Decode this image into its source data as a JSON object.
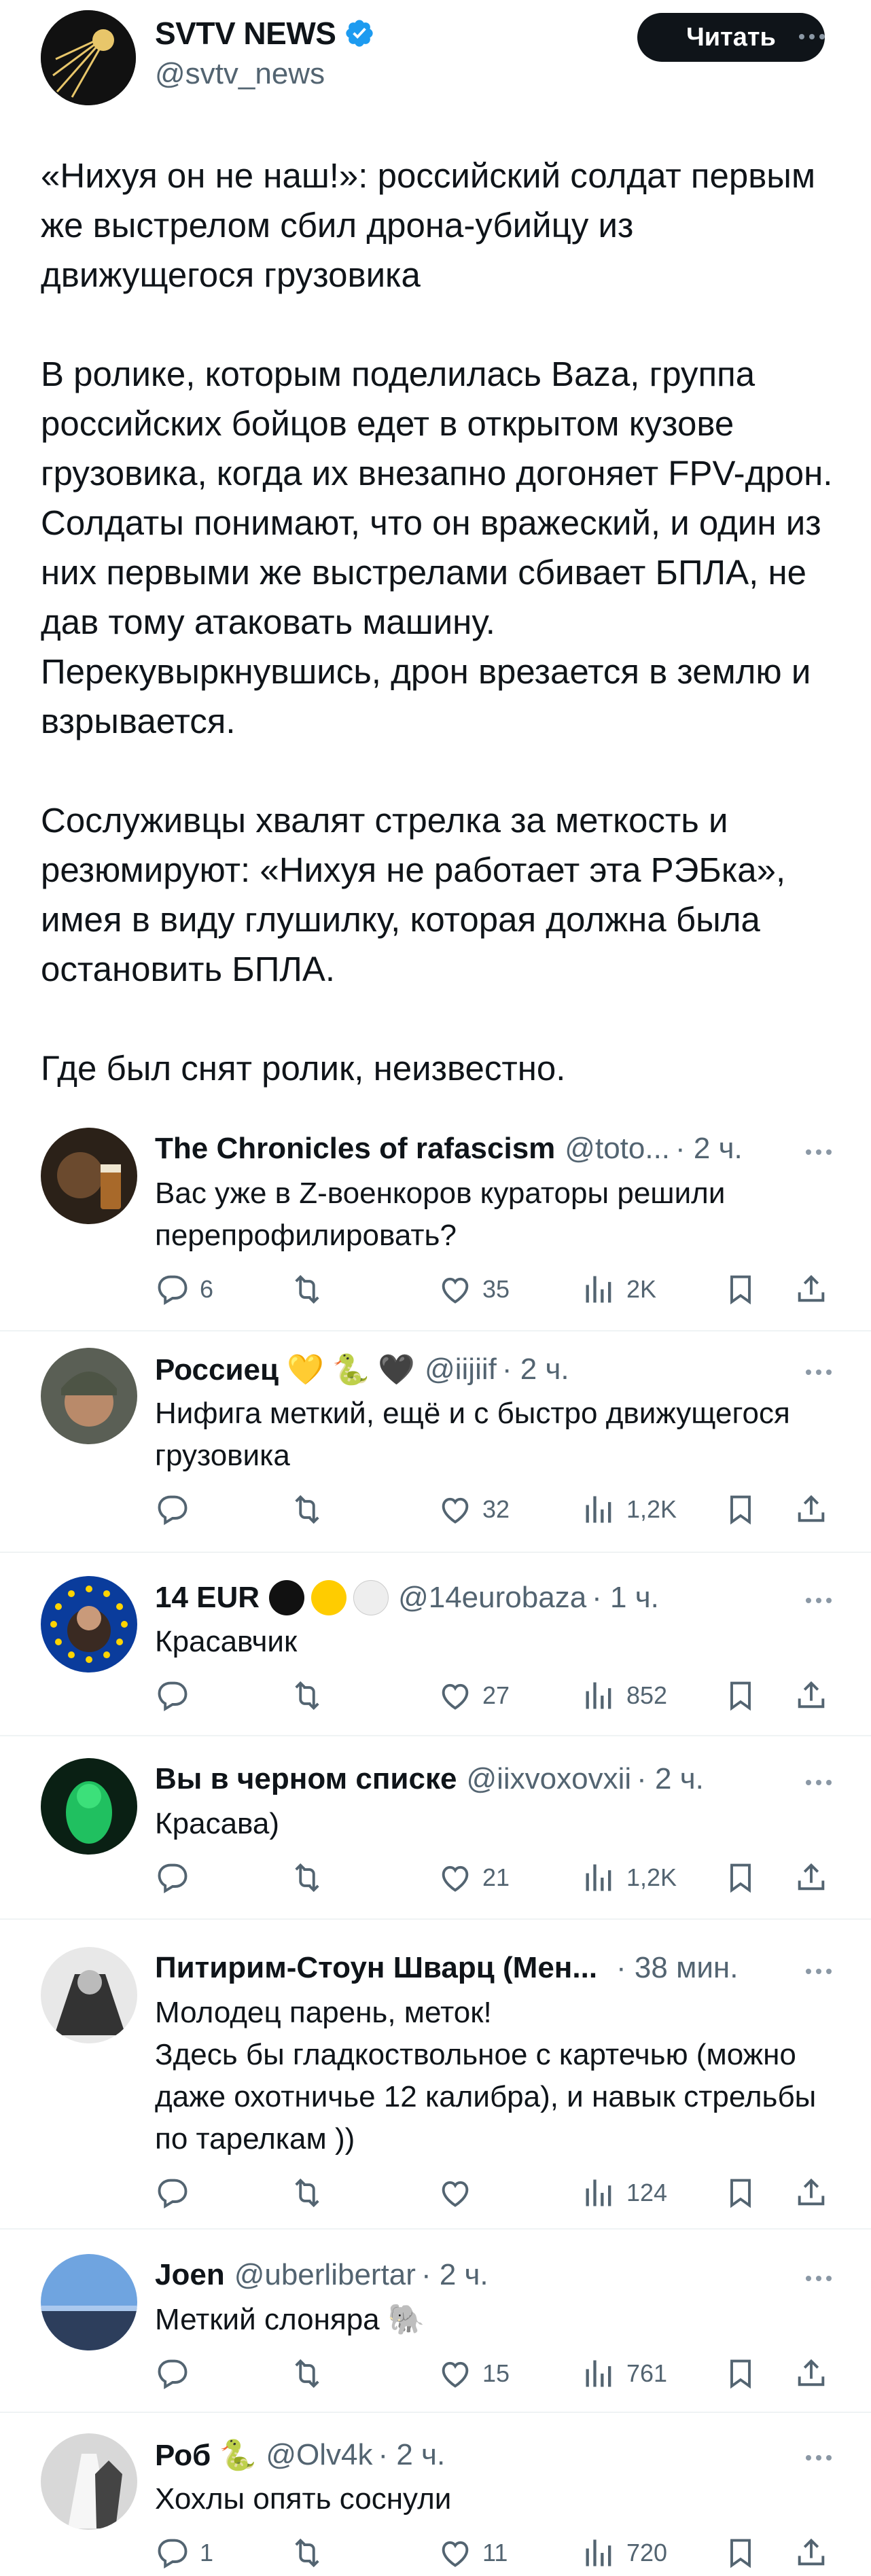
{
  "post": {
    "author_name": "SVTV NEWS",
    "author_handle": "@svtv_news",
    "follow_label": "Читать",
    "paragraphs": [
      "«Нихуя он не наш!»: российский солдат первым же выстрелом сбил дрона-убийцу из движущегося грузовика",
      "В ролике, которым поделилась Baza, группа российских бойцов едет в открытом кузове грузовика, когда их внезапно догоняет FPV-дрон. Солдаты понимают, что он вражеский, и один из них первыми же выстрелами сбивает БПЛА, не дав тому атаковать машину. Перекувыркнувшись, дрон врезается в землю и взрывается.",
      "Сослуживцы хвалят стрелка за меткость и резюмируют: «Нихуя не работает эта РЭБка», имея в виду глушилку, которая должна была остановить БПЛА.",
      "Где был снят ролик, неизвестно."
    ]
  },
  "replies": [
    {
      "name": "The Chronicles of rafascism",
      "handle": "@toto...",
      "time": "· 2 ч.",
      "text": "Вас уже в Z-военкоров кураторы решили перепрофилировать?",
      "replies_count": "6",
      "retweets_count": "",
      "likes": "35",
      "views": "2K"
    },
    {
      "name": "Россиец 💛 🐍 🖤",
      "handle": "@iijiif",
      "time": "· 2 ч.",
      "text": "Нифига меткий, ещё и с быстро движущегося грузовика",
      "replies_count": "",
      "retweets_count": "",
      "likes": "32",
      "views": "1,2K"
    },
    {
      "name": "14 EUR",
      "handle": "@14eurobaza",
      "time": "· 1 ч.",
      "text": "Красавчик",
      "replies_count": "",
      "retweets_count": "",
      "likes": "27",
      "views": "852"
    },
    {
      "name": "Вы в черном списке",
      "handle": "@iixvoxovxii",
      "time": "· 2 ч.",
      "text": "Красава)",
      "replies_count": "",
      "retweets_count": "",
      "likes": "21",
      "views": "1,2K"
    },
    {
      "name": "Питирим-Стоун Шварц (Мен...",
      "handle": "",
      "time": "· 38 мин.",
      "text": "Молодец парень, меток!\nЗдесь бы гладкоствольное с картечью (можно даже охотничье 12 калибра), и навык стрельбы по тарелкам ))",
      "replies_count": "",
      "retweets_count": "",
      "likes": "",
      "views": "124"
    },
    {
      "name": "Joen",
      "handle": "@uberlibertar",
      "time": "· 2 ч.",
      "text": "Меткий слоняра 🐘",
      "replies_count": "",
      "retweets_count": "",
      "likes": "15",
      "views": "761"
    },
    {
      "name": "Роб 🐍",
      "handle": "@Olv4k",
      "time": "· 2 ч.",
      "text": "Хохлы опять соснули",
      "replies_count": "1",
      "retweets_count": "",
      "likes": "11",
      "views": "720"
    }
  ],
  "colors": {
    "text": "#0f1419",
    "secondary": "#536471",
    "verified": "#1d9bf0",
    "divider": "#eff3f4"
  },
  "icons": [
    "verified-badge-icon",
    "more-icon",
    "reply-icon",
    "retweet-icon",
    "like-icon",
    "views-icon",
    "bookmark-icon",
    "share-icon"
  ]
}
